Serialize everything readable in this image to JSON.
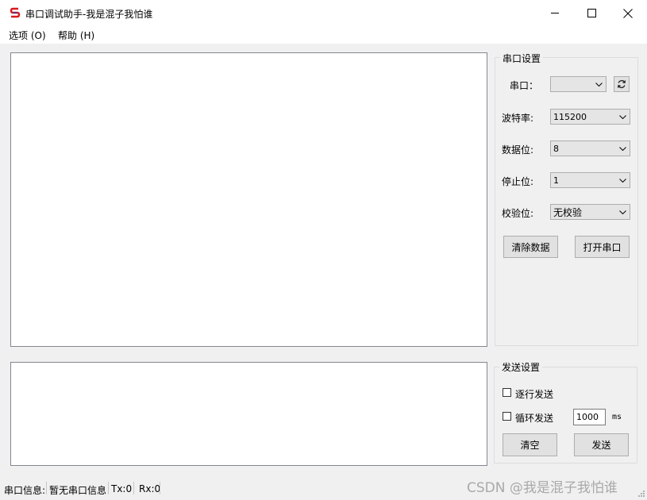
{
  "window": {
    "title": "串口调试助手-我是混子我怕谁"
  },
  "menu": {
    "items": [
      {
        "label": "选项 (O)"
      },
      {
        "label": "帮助 (H)"
      }
    ]
  },
  "serial_settings": {
    "group_title": "串口设置",
    "port_label": "串口：",
    "port_value": "",
    "baud_label": "波特率:",
    "baud_value": "115200",
    "databits_label": "数据位:",
    "databits_value": "8",
    "stopbits_label": "停止位:",
    "stopbits_value": "1",
    "parity_label": "校验位:",
    "parity_value": "无校验",
    "clear_data_button": "清除数据",
    "open_port_button": "打开串口"
  },
  "send_settings": {
    "group_title": "发送设置",
    "line_send_label": "逐行发送",
    "line_send_checked": false,
    "loop_send_label": "循环发送",
    "loop_send_checked": false,
    "interval_value": "1000",
    "interval_unit": "ms",
    "clear_button": "清空",
    "send_button": "发送"
  },
  "status_bar": {
    "info_label": "串口信息:",
    "info_value": "暂无串口信息",
    "tx": "Tx:0",
    "rx": "Rx:0"
  },
  "watermark": "CSDN @我是混子我怕谁",
  "icons": {
    "app": "app-logo-icon",
    "minimize": "minimize-icon",
    "maximize": "maximize-icon",
    "close": "close-icon",
    "refresh": "refresh-icon",
    "dropdown": "chevron-down-icon"
  },
  "colors": {
    "window_bg": "#f0f0f0",
    "textbox_bg": "#ffffff",
    "logo_red": "#d9181f",
    "logo_blue": "#1d3fa8"
  }
}
